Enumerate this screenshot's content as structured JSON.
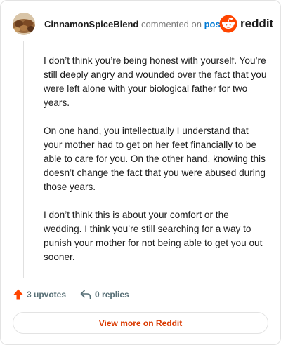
{
  "header": {
    "username": "CinnamonSpiceBlend",
    "action_text": "commented on",
    "post_link": "post",
    "brand_name": "reddit"
  },
  "comment": {
    "paragraphs": [
      "I don’t think you’re being honest with yourself. You’re still deeply angry and wounded over the fact that you were left alone with your biological father for two years.",
      "On one hand, you intellectually I understand that your mother had to get on her feet financially to be able to care for you. On the other hand, knowing this doesn’t change the fact that you were abused during those years.",
      "I don’t think this is about your comfort or the wedding. I think you’re still searching for a way to punish your mother for not being able to get you out sooner."
    ]
  },
  "actions": {
    "upvotes": "3 upvotes",
    "replies": "0 replies"
  },
  "footer": {
    "view_more": "View more on Reddit"
  },
  "colors": {
    "brand_orange": "#ff4500",
    "link_blue": "#0079d3",
    "button_text": "#d93900"
  },
  "icons": {
    "avatar": "avatar-image",
    "logo": "reddit-snoo-icon",
    "upvote": "upvote-arrow-icon",
    "reply": "reply-arrow-icon"
  }
}
